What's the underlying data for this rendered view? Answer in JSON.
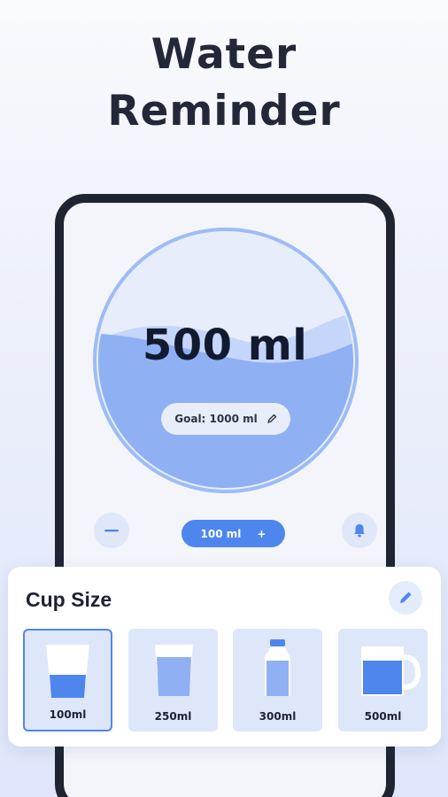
{
  "headline": {
    "line1": "Water",
    "line2": "Reminder"
  },
  "tracker": {
    "amount": "500 ml",
    "goal_label": "Goal: 1000 ml",
    "add_button_label": "100 ml",
    "add_button_plus": "+",
    "fill_fraction": 0.5
  },
  "cup_card": {
    "title": "Cup Size",
    "cups": [
      {
        "label": "100ml",
        "selected": true
      },
      {
        "label": "250ml",
        "selected": false
      },
      {
        "label": "300ml",
        "selected": false
      },
      {
        "label": "500ml",
        "selected": false
      }
    ]
  },
  "colors": {
    "accent": "#4f86ee",
    "water": "#8fb0f3",
    "water_light": "#c5d6fa",
    "bowl_ring": "#9dbcf5",
    "phone_frame": "#1f2433"
  },
  "icons": {
    "goal_edit": "pencil-icon",
    "decrease": "minus-icon",
    "reminder": "bell-icon",
    "cup_edit": "pencil-icon"
  }
}
